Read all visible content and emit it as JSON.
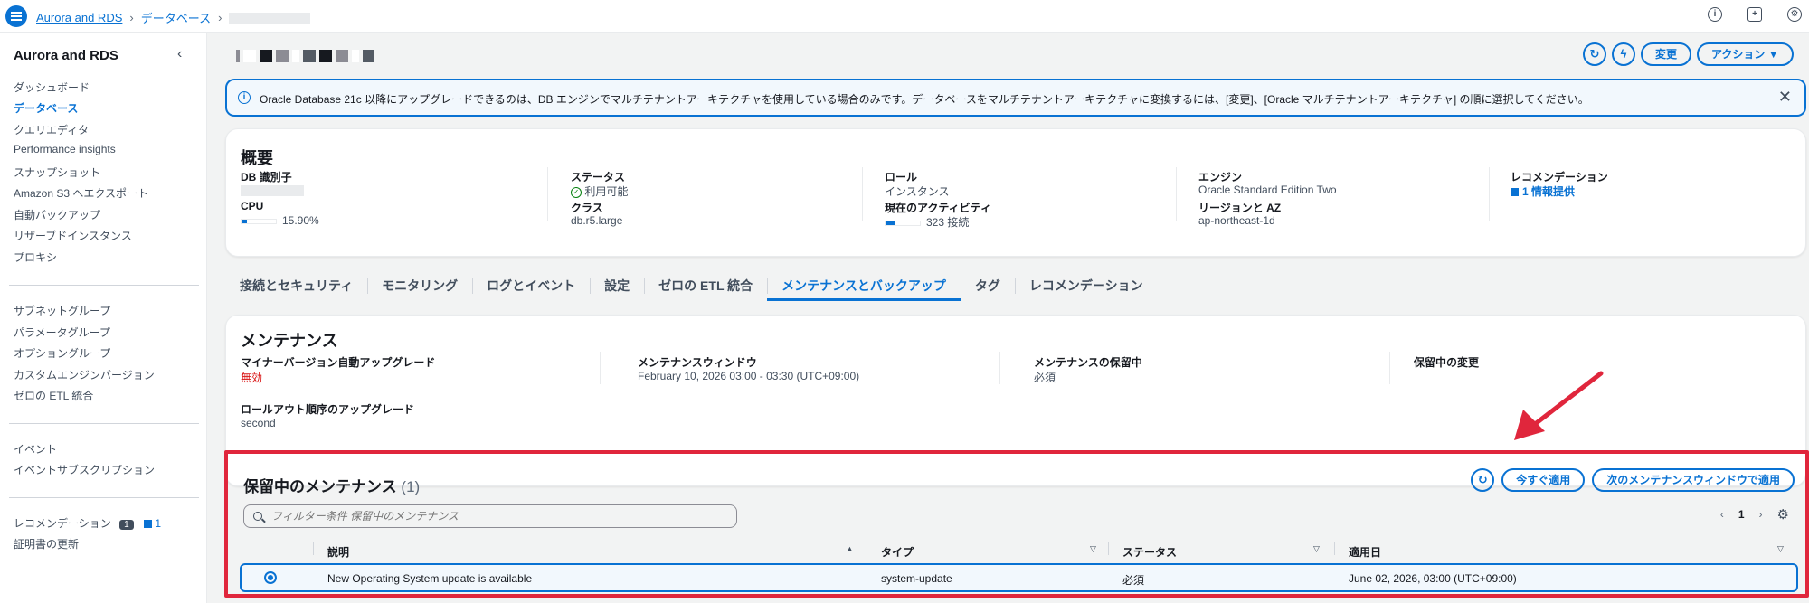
{
  "breadcrumb": {
    "service": "Aurora and RDS",
    "section": "データベース"
  },
  "sidebar": {
    "title": "Aurora and RDS",
    "group1": [
      "ダッシュボード",
      "データベース",
      "クエリエディタ",
      "Performance insights",
      "スナップショット",
      "Amazon S3 へエクスポート",
      "自動バックアップ",
      "リザーブドインスタンス",
      "プロキシ"
    ],
    "group2": [
      "サブネットグループ",
      "パラメータグループ",
      "オプショングループ",
      "カスタムエンジンバージョン",
      "ゼロの ETL 統合"
    ],
    "group3": [
      "イベント",
      "イベントサブスクリプション"
    ],
    "recommend_label": "レコメンデーション",
    "recommend_count": "1",
    "recommend_info_count": "1",
    "cert_label": "証明書の更新"
  },
  "header": {
    "modify_label": "変更",
    "actions_label": "アクション ▼"
  },
  "alert": {
    "text": "Oracle Database 21c 以降にアップグレードできるのは、DB エンジンでマルチテナントアーキテクチャを使用している場合のみです。データベースをマルチテナントアーキテクチャに変換するには、[変更]、[Oracle マルチテナントアーキテクチャ] の順に選択してください。"
  },
  "summary": {
    "title": "概要",
    "db_id_label": "DB 識別子",
    "cpu_label": "CPU",
    "cpu_value": "15.90%",
    "cpu_level": 0.159,
    "status_label": "ステータス",
    "status_value": "利用可能",
    "class_label": "クラス",
    "class_value": "db.r5.large",
    "role_label": "ロール",
    "role_value": "インスタンス",
    "activity_label": "現在のアクティビティ",
    "activity_value": "323 接続",
    "engine_label": "エンジン",
    "engine_value": "Oracle Standard Edition Two",
    "region_label": "リージョンと AZ",
    "region_value": "ap-northeast-1d",
    "recommend_label": "レコメンデーション",
    "recommend_value": "1 情報提供"
  },
  "tabs": [
    "接続とセキュリティ",
    "モニタリング",
    "ログとイベント",
    "設定",
    "ゼロの ETL 統合",
    "メンテナンスとバックアップ",
    "タグ",
    "レコメンデーション"
  ],
  "maintenance": {
    "title": "メンテナンス",
    "minor_label": "マイナーバージョン自動アップグレード",
    "minor_value": "無効",
    "window_label": "メンテナンスウィンドウ",
    "window_value": "February 10, 2026 03:00 - 03:30 (UTC+09:00)",
    "pending_label": "メンテナンスの保留中",
    "pending_value": "必須",
    "changes_label": "保留中の変更",
    "rollout_label": "ロールアウト順序のアップグレード",
    "rollout_value": "second"
  },
  "pending": {
    "title": "保留中のメンテナンス",
    "count": "(1)",
    "apply_now": "今すぐ適用",
    "apply_next": "次のメンテナンスウィンドウで適用",
    "search_placeholder": "フィルター条件 保留中のメンテナンス",
    "page": "1",
    "columns": {
      "description": "説明",
      "type": "タイプ",
      "status": "ステータス",
      "applied": "適用日"
    },
    "row": {
      "description": "New Operating System update is available",
      "type": "system-update",
      "status": "必須",
      "applied": "June 02, 2026, 03:00 (UTC+09:00)"
    }
  },
  "colors": {
    "accent": "#0972d3",
    "highlight": "#e0263c",
    "error": "#d91515",
    "success": "#037f0c"
  }
}
